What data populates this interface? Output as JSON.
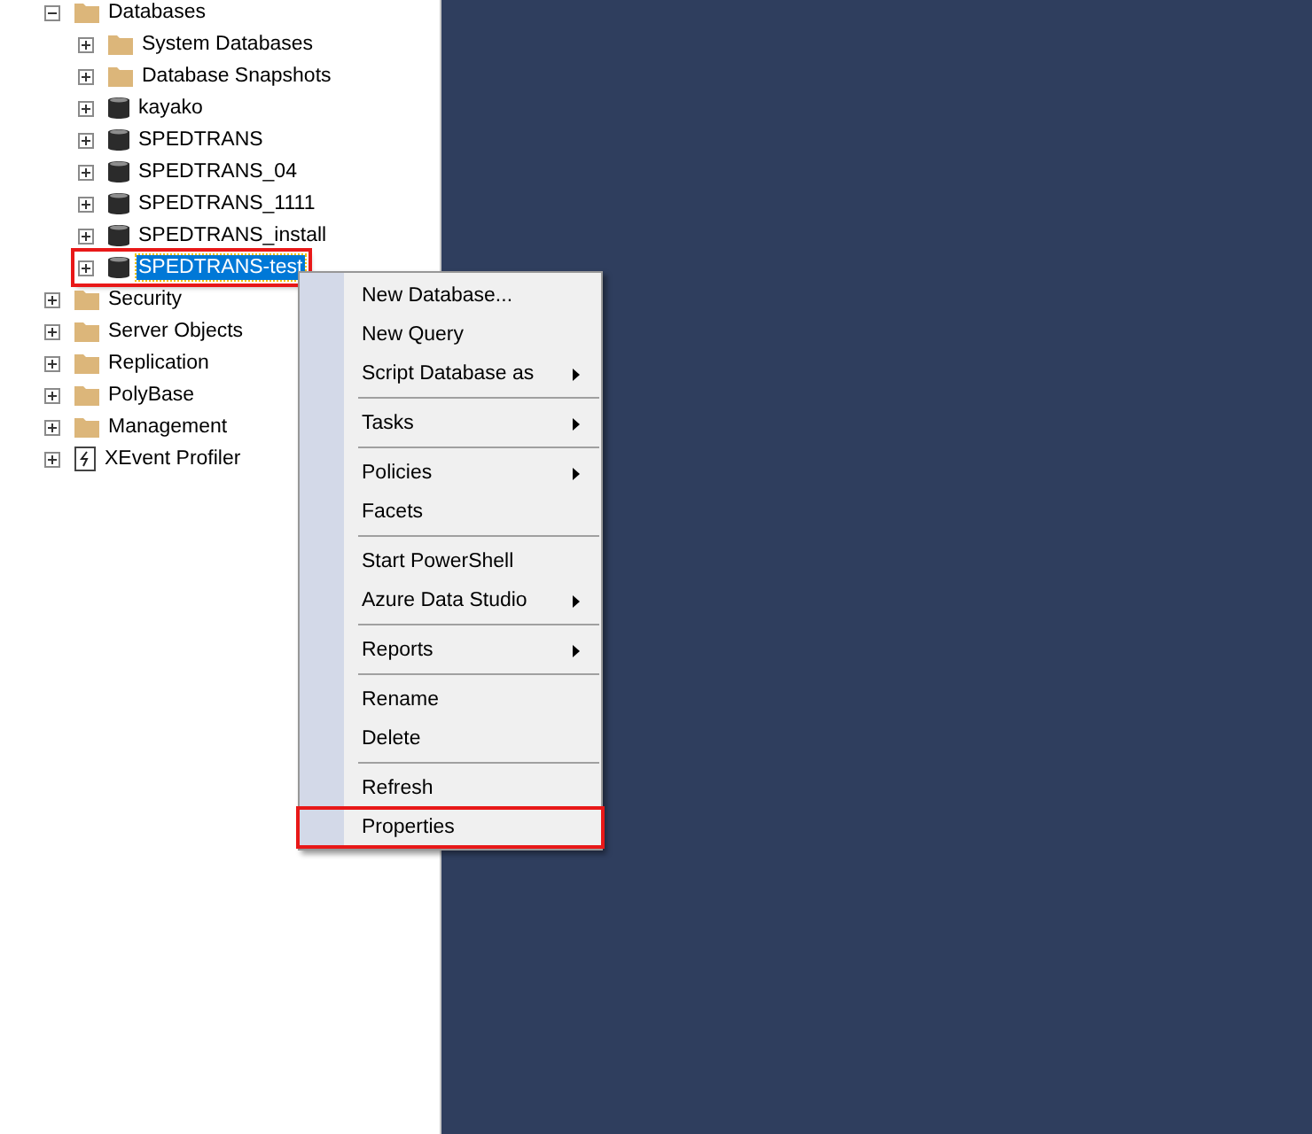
{
  "tree": [
    {
      "label": "Databases",
      "kind": "folder",
      "expanded": true,
      "selected": false,
      "highlighted": false,
      "children": [
        {
          "label": "System Databases",
          "kind": "folder",
          "expanded": false,
          "selected": false,
          "highlighted": false
        },
        {
          "label": "Database Snapshots",
          "kind": "folder",
          "expanded": false,
          "selected": false,
          "highlighted": false
        },
        {
          "label": "kayako",
          "kind": "database",
          "expanded": false,
          "selected": false,
          "highlighted": false
        },
        {
          "label": "SPEDTRANS",
          "kind": "database",
          "expanded": false,
          "selected": false,
          "highlighted": false
        },
        {
          "label": "SPEDTRANS_04",
          "kind": "database",
          "expanded": false,
          "selected": false,
          "highlighted": false
        },
        {
          "label": "SPEDTRANS_1111",
          "kind": "database",
          "expanded": false,
          "selected": false,
          "highlighted": false
        },
        {
          "label": "SPEDTRANS_install",
          "kind": "database",
          "expanded": false,
          "selected": false,
          "highlighted": false
        },
        {
          "label": "SPEDTRANS-test",
          "kind": "database",
          "expanded": false,
          "selected": true,
          "highlighted": true
        }
      ]
    },
    {
      "label": "Security",
      "kind": "folder",
      "expanded": false,
      "selected": false,
      "highlighted": false
    },
    {
      "label": "Server Objects",
      "kind": "folder",
      "expanded": false,
      "selected": false,
      "highlighted": false
    },
    {
      "label": "Replication",
      "kind": "folder",
      "expanded": false,
      "selected": false,
      "highlighted": false
    },
    {
      "label": "PolyBase",
      "kind": "folder",
      "expanded": false,
      "selected": false,
      "highlighted": false
    },
    {
      "label": "Management",
      "kind": "folder",
      "expanded": false,
      "selected": false,
      "highlighted": false
    },
    {
      "label": "XEvent Profiler",
      "kind": "xevent",
      "expanded": false,
      "selected": false,
      "highlighted": false
    }
  ],
  "context_menu": [
    {
      "kind": "item",
      "label": "New Database...",
      "submenu": false,
      "highlighted": false
    },
    {
      "kind": "item",
      "label": "New Query",
      "submenu": false,
      "highlighted": false
    },
    {
      "kind": "item",
      "label": "Script Database as",
      "submenu": true,
      "highlighted": false
    },
    {
      "kind": "separator"
    },
    {
      "kind": "item",
      "label": "Tasks",
      "submenu": true,
      "highlighted": false
    },
    {
      "kind": "separator"
    },
    {
      "kind": "item",
      "label": "Policies",
      "submenu": true,
      "highlighted": false
    },
    {
      "kind": "item",
      "label": "Facets",
      "submenu": false,
      "highlighted": false
    },
    {
      "kind": "separator"
    },
    {
      "kind": "item",
      "label": "Start PowerShell",
      "submenu": false,
      "highlighted": false
    },
    {
      "kind": "item",
      "label": "Azure Data Studio",
      "submenu": true,
      "highlighted": false
    },
    {
      "kind": "separator"
    },
    {
      "kind": "item",
      "label": "Reports",
      "submenu": true,
      "highlighted": false
    },
    {
      "kind": "separator"
    },
    {
      "kind": "item",
      "label": "Rename",
      "submenu": false,
      "highlighted": false
    },
    {
      "kind": "item",
      "label": "Delete",
      "submenu": false,
      "highlighted": false
    },
    {
      "kind": "separator"
    },
    {
      "kind": "item",
      "label": "Refresh",
      "submenu": false,
      "highlighted": false
    },
    {
      "kind": "item",
      "label": "Properties",
      "submenu": false,
      "highlighted": true
    }
  ]
}
